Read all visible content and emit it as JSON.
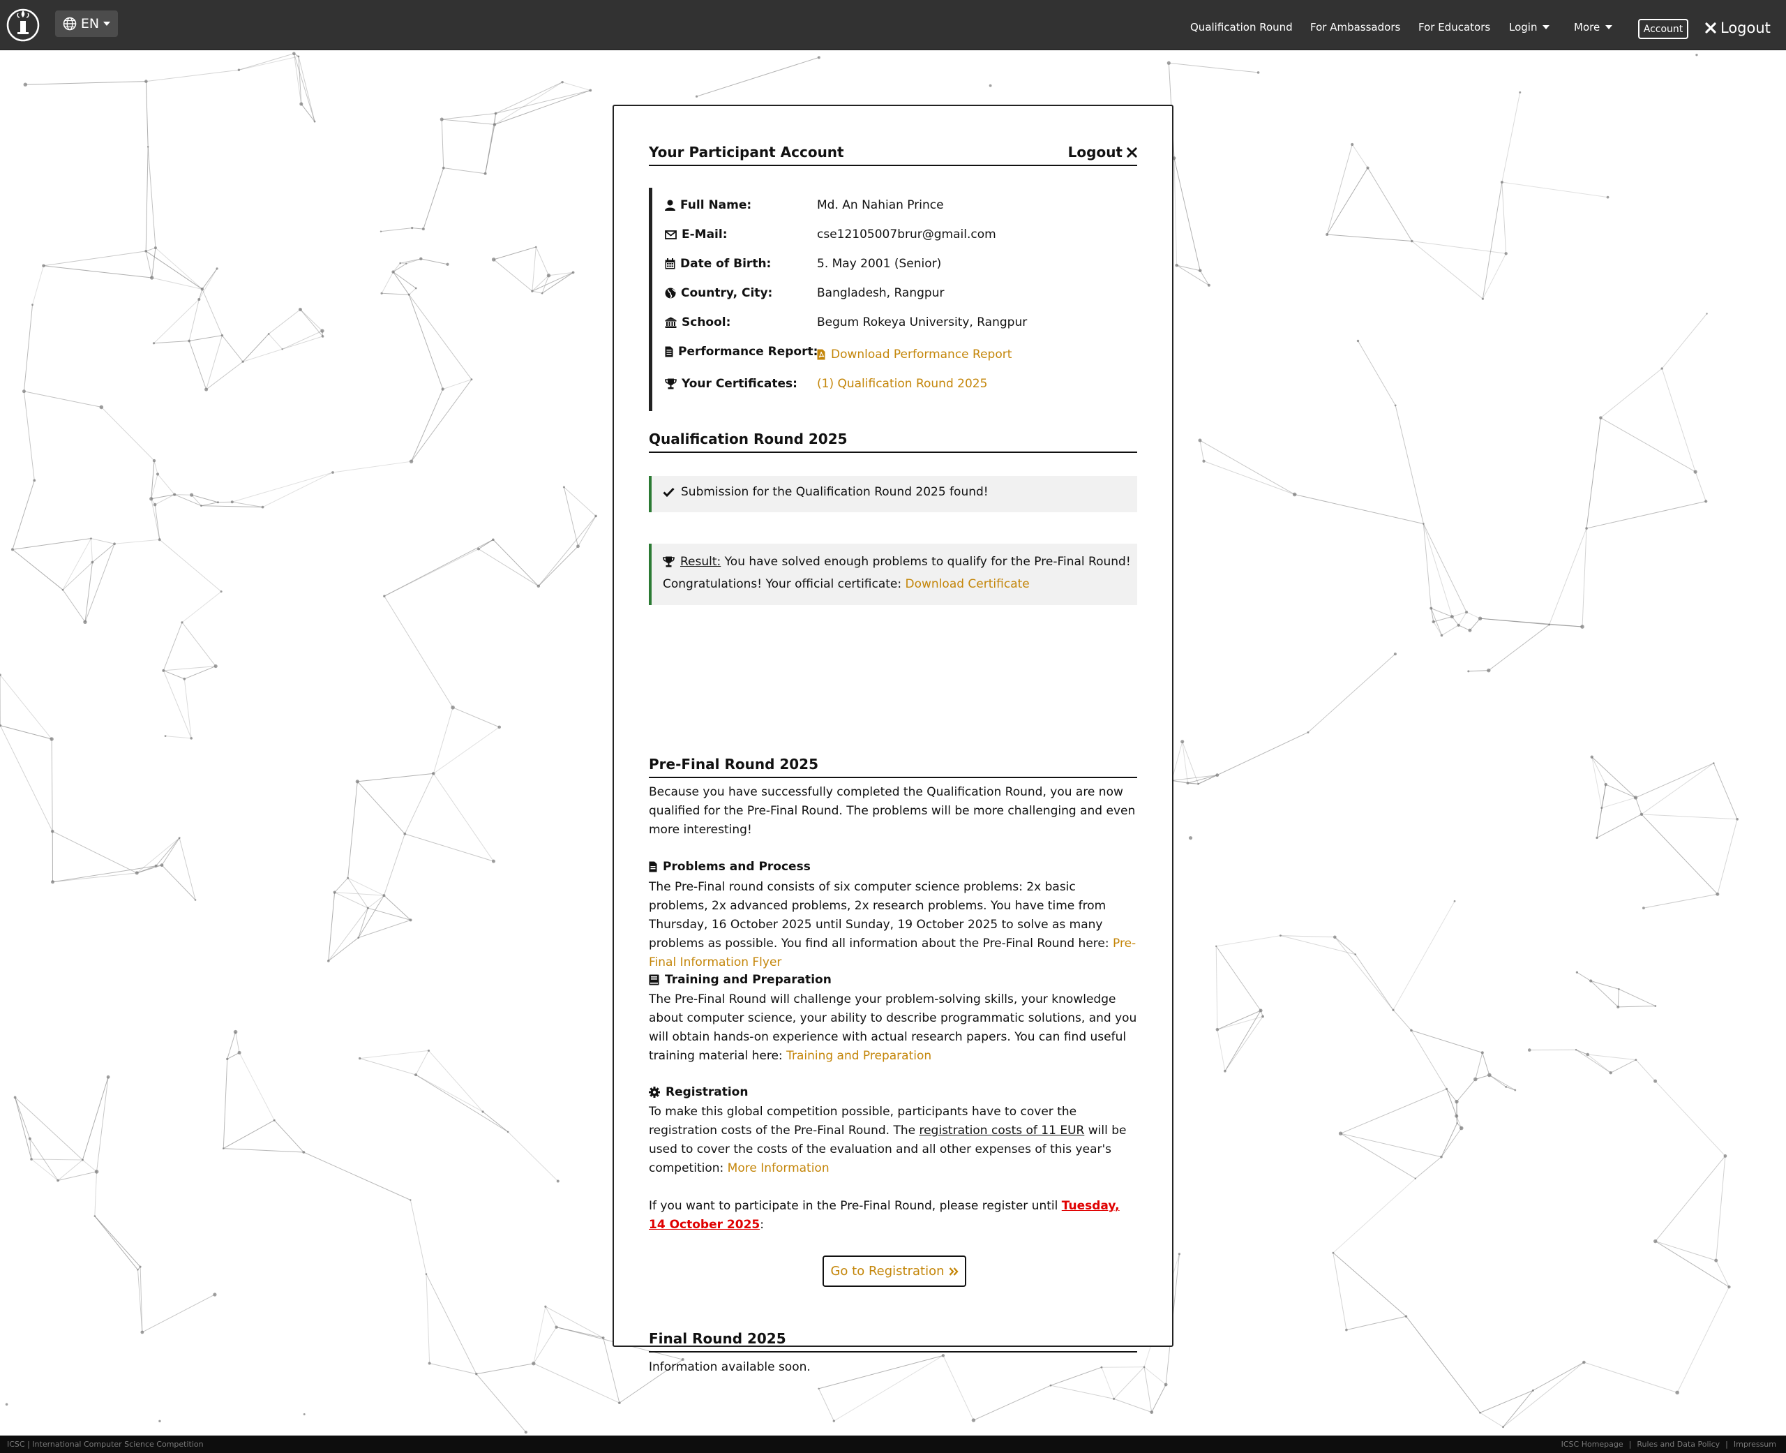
{
  "nav": {
    "language": "EN",
    "items": [
      {
        "label": "Qualification Round"
      },
      {
        "label": "For Ambassadors"
      },
      {
        "label": "For Educators"
      },
      {
        "label": "Login"
      },
      {
        "label": "More"
      }
    ],
    "account_label": "Account",
    "logout_label": "Logout"
  },
  "account": {
    "title": "Your Participant Account",
    "logout_label": "Logout",
    "fields": [
      {
        "label": "Full Name:",
        "value": "Md. An Nahian Prince",
        "icon": "user-icon"
      },
      {
        "label": "E-Mail:",
        "value": "cse12105007brur@gmail.com",
        "icon": "envelope-icon"
      },
      {
        "label": "Date of Birth:",
        "value": "5. May 2001 (Senior)",
        "icon": "calendar-icon"
      },
      {
        "label": "Country, City:",
        "value": "Bangladesh, Rangpur",
        "icon": "globe-icon"
      },
      {
        "label": "School:",
        "value": "Begum Rokeya University, Rangpur",
        "icon": "institution-icon"
      },
      {
        "label": "Performance Report:",
        "value": "Download Performance Report",
        "icon": "report-icon"
      },
      {
        "label": "Your Certificates:",
        "value": "(1) Qualification Round 2025",
        "icon": "trophy-icon"
      }
    ]
  },
  "qualification": {
    "title": "Qualification Round 2025",
    "submission_alert": "Submission for the Qualification Round 2025 found!",
    "result_label": "Result:",
    "result_text": " You have solved enough problems to qualify for the Pre-Final Round!",
    "congrats_text": "Congratulations! Your official certificate: ",
    "certificate_link": "Download Certificate"
  },
  "prefinal": {
    "title": "Pre-Final Round 2025",
    "intro": "Because you have successfully completed the Qualification Round, you are now qualified for the Pre-Final Round. The problems will be more challenging and even more interesting!",
    "problems_title": "Problems and Process",
    "problems_text": "The Pre-Final round consists of six computer science problems: 2x basic problems, 2x advanced problems, 2x research problems. You have time from Thursday, 16 October 2025 until Sunday, 19 October 2025 to solve as many problems as possible. You find all information about the Pre-Final Round here: ",
    "problems_link": "Pre-Final Information Flyer",
    "training_title": "Training and Preparation",
    "training_text": "The Pre-Final Round will challenge your problem-solving skills, your knowledge about computer science, your ability to describe programmatic solutions, and you will obtain hands-on experience with actual research papers. You can find useful training material here: ",
    "training_link": "Training and Preparation",
    "registration_title": "Registration",
    "registration_text_1": "To make this global competition possible, participants have to cover the registration costs of the Pre-Final Round. The ",
    "registration_costs": "registration costs of 11 EUR",
    "registration_text_2": " will be used to cover the costs of the evaluation and all other expenses of this year's competition: ",
    "registration_link": "More Information",
    "deadline_text": "If you want to participate in the Pre-Final Round, please register until ",
    "deadline_date": "Tuesday, 14 October 2025",
    "deadline_suffix": ":",
    "register_button": "Go to Registration"
  },
  "final": {
    "title": "Final Round 2025",
    "text": "Information available soon."
  },
  "footer": {
    "left": "ICSC | International Computer Science Competition",
    "links": [
      "ICSC Homepage",
      "|",
      "Rules and Data Policy",
      "|",
      "Impressum"
    ]
  },
  "colors": {
    "navbar": "#323232",
    "link": "#c4860a",
    "deadline": "#e00000",
    "alert_border": "#2b7a33"
  }
}
